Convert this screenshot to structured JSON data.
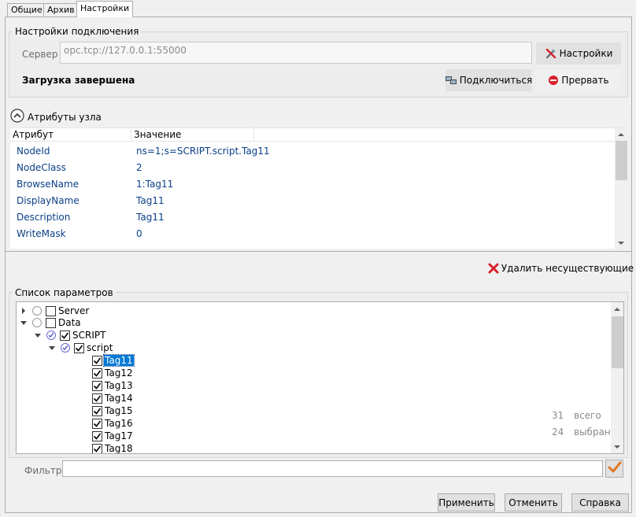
{
  "tabs": [
    {
      "label": "Общие"
    },
    {
      "label": "Архив"
    },
    {
      "label": "Настройки"
    }
  ],
  "connection": {
    "title": "Настройки подключения",
    "server_label": "Сервер",
    "server_value": "opc.tcp://127.0.0.1:55000",
    "settings_button": "Настройки",
    "status": "Загрузка завершена",
    "connect_button": "Подключиться",
    "abort_button": "Прервать"
  },
  "attributes": {
    "title": "Атрибуты узла",
    "col_attr": "Атрибут",
    "col_value": "Значение",
    "rows": [
      {
        "name": "NodeId",
        "value": "ns=1;s=SCRIPT.script.Tag11"
      },
      {
        "name": "NodeClass",
        "value": "2"
      },
      {
        "name": "BrowseName",
        "value": "1:Tag11"
      },
      {
        "name": "DisplayName",
        "value": "Tag11"
      },
      {
        "name": "Description",
        "value": "Tag11"
      },
      {
        "name": "WriteMask",
        "value": "0"
      }
    ]
  },
  "params": {
    "delete_button": "Удалить несуществующие",
    "title": "Список параметров",
    "tree": [
      {
        "label": "Server",
        "level": 0,
        "expander": "collapsed",
        "radio": "off",
        "checked": false
      },
      {
        "label": "Data",
        "level": 0,
        "expander": "expanded",
        "radio": "off",
        "checked": false
      },
      {
        "label": "SCRIPT",
        "level": 1,
        "expander": "expanded",
        "radio": "on",
        "checked": true
      },
      {
        "label": "script",
        "level": 2,
        "expander": "expanded",
        "radio": "on",
        "checked": true
      },
      {
        "label": "Tag11",
        "level": 3,
        "checked": true,
        "selected": true
      },
      {
        "label": "Tag12",
        "level": 3,
        "checked": true
      },
      {
        "label": "Tag13",
        "level": 3,
        "checked": true
      },
      {
        "label": "Tag14",
        "level": 3,
        "checked": true
      },
      {
        "label": "Tag15",
        "level": 3,
        "checked": true
      },
      {
        "label": "Tag16",
        "level": 3,
        "checked": true
      },
      {
        "label": "Tag17",
        "level": 3,
        "checked": true
      },
      {
        "label": "Tag18",
        "level": 3,
        "checked": true
      }
    ],
    "total_count": "31",
    "total_label": "всего",
    "selected_count": "24",
    "selected_label": "выбрано",
    "filter_label": "Фильтр",
    "filter_value": ""
  },
  "footer": {
    "apply": "Применить",
    "cancel": "Отменить",
    "help": "Справка"
  },
  "colors": {
    "selection": "#0078d7",
    "link_text": "#0a3f87",
    "abort_icon": "#d8202a",
    "delete_icon": "#d8202a",
    "filter_tick": "#e07a28"
  }
}
